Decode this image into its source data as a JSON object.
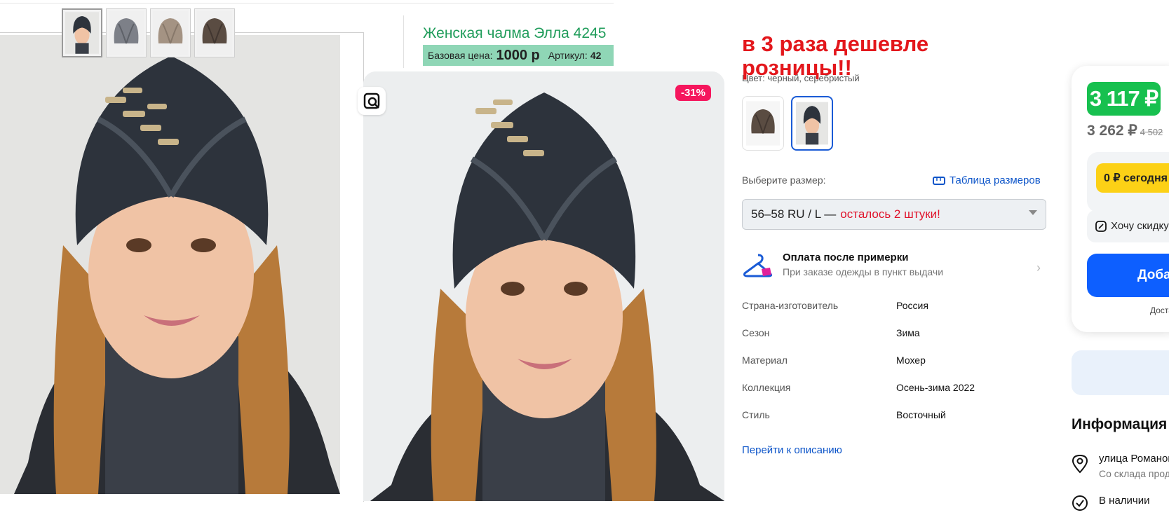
{
  "supplier": {
    "product_title": "Женская чалма Элла 4245",
    "base_price_label": "Базовая цена:",
    "base_price": "1000 р",
    "article_label": "Артикул:",
    "article_value": "42"
  },
  "promo_text": "в 3 раза дешевле розницы!!",
  "market": {
    "discount_badge": "-31%",
    "color_line": "Цвет: черный, серебристый",
    "size_prompt": "Выберите размер:",
    "size_table_link": "Таблица размеров",
    "size_selected": "56–58 RU / L —",
    "size_stock": "осталось 2 штуки!",
    "pay_after_title": "Оплата после примерки",
    "pay_after_sub": "При заказе одежды в пункт выдачи",
    "specs": [
      {
        "key": "Страна-изготовитель",
        "value": "Россия",
        "link": true
      },
      {
        "key": "Сезон",
        "value": "Зима",
        "link": true
      },
      {
        "key": "Материал",
        "value": "Мохер",
        "link": false
      },
      {
        "key": "Коллекция",
        "value": "Осень-зима 2022",
        "link": false
      },
      {
        "key": "Стиль",
        "value": "Восточный",
        "link": false
      }
    ],
    "description_link": "Перейти к описанию"
  },
  "buy_panel": {
    "price": "3 117 ₽",
    "wallet_price": "3 262 ₽",
    "old_price": "4 502",
    "today_label": "0 ₽ сегодня",
    "want_discount": "Хочу скидку",
    "add_button": "Добавить",
    "delivery": "Доставка",
    "info_heading": "Информация",
    "address_line": "улица Романова",
    "address_sub": "Со склада продавца",
    "stock_line": "В наличии"
  },
  "colors": {
    "supplier_green": "#1f9c5a",
    "price_bar": "#8fd6b6",
    "promo_red": "#e3171c",
    "discount_pink": "#f5165d",
    "price_green": "#17c04f",
    "today_yellow": "#fcd116",
    "add_blue": "#0d5fff",
    "link_blue": "#0d55c9"
  }
}
